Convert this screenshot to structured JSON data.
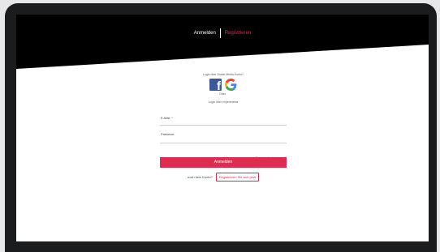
{
  "nav": {
    "login_label": "Anmelden",
    "register_label": "Registrieren"
  },
  "social": {
    "caption": "Login über Social-Media-Konto?",
    "facebook_icon": "facebook-icon",
    "google_icon": "google-icon",
    "google_label": "Oder"
  },
  "alt_caption": "Login über experimenta",
  "form": {
    "email_label": "E-Mail",
    "email_required": "*",
    "password_label": "Passwort",
    "forgot_label": "Passwort vergessen?",
    "submit_label": "Anmelden"
  },
  "register": {
    "prompt": "noch kein Konto?",
    "button_label": "Registrieren Sie sich jetzt"
  },
  "colors": {
    "accent": "#df2b4f",
    "header": "#000000",
    "frame": "#1b1c1e",
    "facebook": "#3b5998"
  }
}
